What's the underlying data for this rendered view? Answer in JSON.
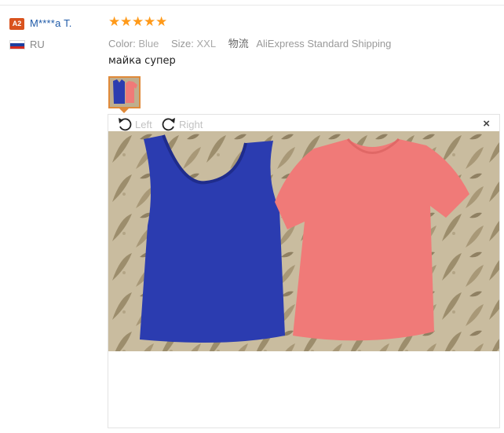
{
  "review": {
    "buyer": {
      "level_badge": "A2",
      "name": "M****a T.",
      "country": "RU"
    },
    "rating_stars": 5,
    "attributes": {
      "color_label": "Color:",
      "color_value": "Blue",
      "size_label": "Size:",
      "size_value": "XXL",
      "shipping_label": "物流",
      "shipping_value": "AliExpress Standard Shipping"
    },
    "text": "майка супер"
  },
  "viewer": {
    "rotate_left_label": "Left",
    "rotate_right_label": "Right",
    "close_glyph": "×"
  },
  "colors": {
    "star": "#ff9a1a",
    "badge": "#d9531e",
    "name_link": "#1f5aa8",
    "thumb_border": "#e08a3a",
    "top_blue": "#2b3cb0",
    "tee_pink": "#f07a78"
  },
  "icons": {
    "rotate_left": "rotate-ccw-icon",
    "rotate_right": "rotate-cw-icon",
    "close": "close-icon",
    "flag": "russia-flag-icon",
    "star": "star-icon"
  }
}
